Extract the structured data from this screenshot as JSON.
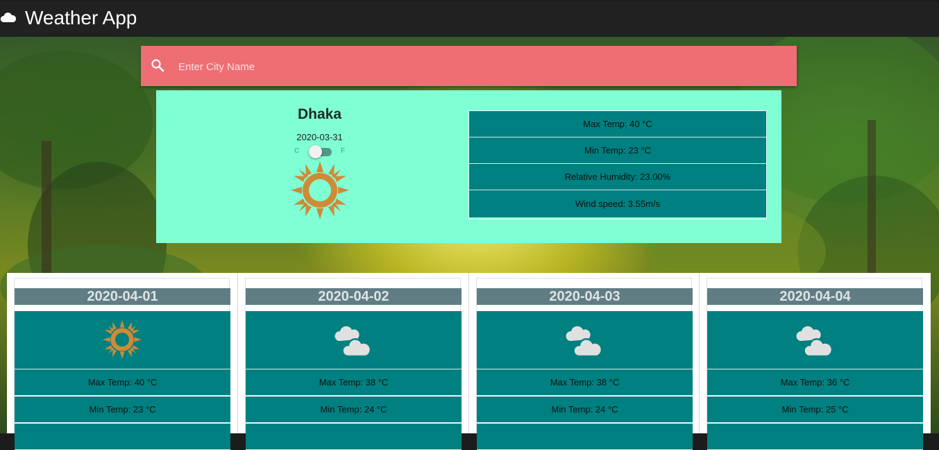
{
  "app": {
    "title": "Weather App",
    "icon": "cloud-icon"
  },
  "search": {
    "placeholder": "Enter City Name",
    "value": "",
    "icon": "search-icon"
  },
  "current": {
    "city": "Dhaka",
    "date": "2020-03-31",
    "unit_c": "C",
    "unit_f": "F",
    "unit_selected": "C",
    "icon": "sun-icon",
    "stats": [
      "Max Temp: 40 °C",
      "Min Temp: 23 °C",
      "Relative Humidity: 23.00%",
      "Wind speed: 3.55m/s"
    ]
  },
  "forecast": [
    {
      "date": "2020-04-01",
      "icon": "sun-icon",
      "max": "Max Temp: 40 °C",
      "min": "Min Temp: 23 °C"
    },
    {
      "date": "2020-04-02",
      "icon": "clouds-icon",
      "max": "Max Temp: 38 °C",
      "min": "Min Temp: 24 °C"
    },
    {
      "date": "2020-04-03",
      "icon": "clouds-icon",
      "max": "Max Temp: 38 °C",
      "min": "Min Temp: 24 °C"
    },
    {
      "date": "2020-04-04",
      "icon": "clouds-icon",
      "max": "Max Temp: 36 °C",
      "min": "Min Temp: 25 °C"
    }
  ],
  "colors": {
    "header": "#212121",
    "search_bar": "#ee6e73",
    "current_card": "#80ffd4",
    "stat_bg": "#008080",
    "forecast_date_bg": "#607d84",
    "sun": "#cf8a36"
  }
}
